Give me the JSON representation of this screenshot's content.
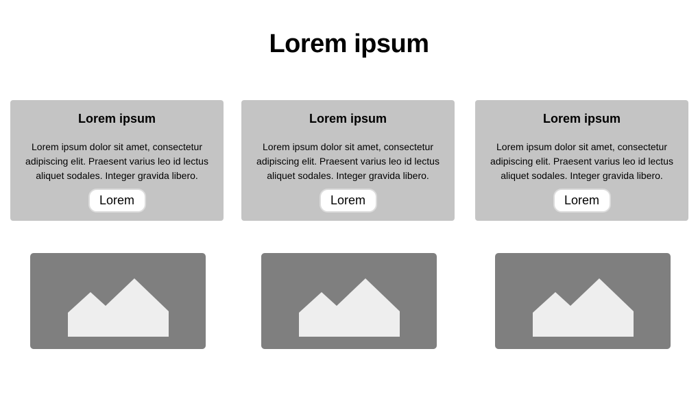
{
  "header": {
    "title": "Lorem ipsum"
  },
  "cards": [
    {
      "title": "Lorem ipsum",
      "body": "Lorem ipsum dolor sit amet, consectetur adipiscing elit. Praesent varius leo id lectus aliquet sodales. Integer gravida libero.",
      "button_label": "Lorem"
    },
    {
      "title": "Lorem ipsum",
      "body": "Lorem ipsum dolor sit amet, consectetur adipiscing elit. Praesent varius leo id lectus aliquet sodales. Integer gravida libero.",
      "button_label": "Lorem"
    },
    {
      "title": "Lorem ipsum",
      "body": "Lorem ipsum dolor sit amet, consectetur adipiscing elit. Praesent varius leo id lectus aliquet sodales. Integer gravida libero.",
      "button_label": "Lorem"
    }
  ],
  "images": [
    {
      "icon": "image-placeholder-icon"
    },
    {
      "icon": "image-placeholder-icon"
    },
    {
      "icon": "image-placeholder-icon"
    }
  ],
  "colors": {
    "card_background": "#c4c4c4",
    "image_background": "#7f7f7f",
    "image_icon": "#eeeeee",
    "button_background": "#ffffff",
    "button_border": "#dcdcdc"
  }
}
